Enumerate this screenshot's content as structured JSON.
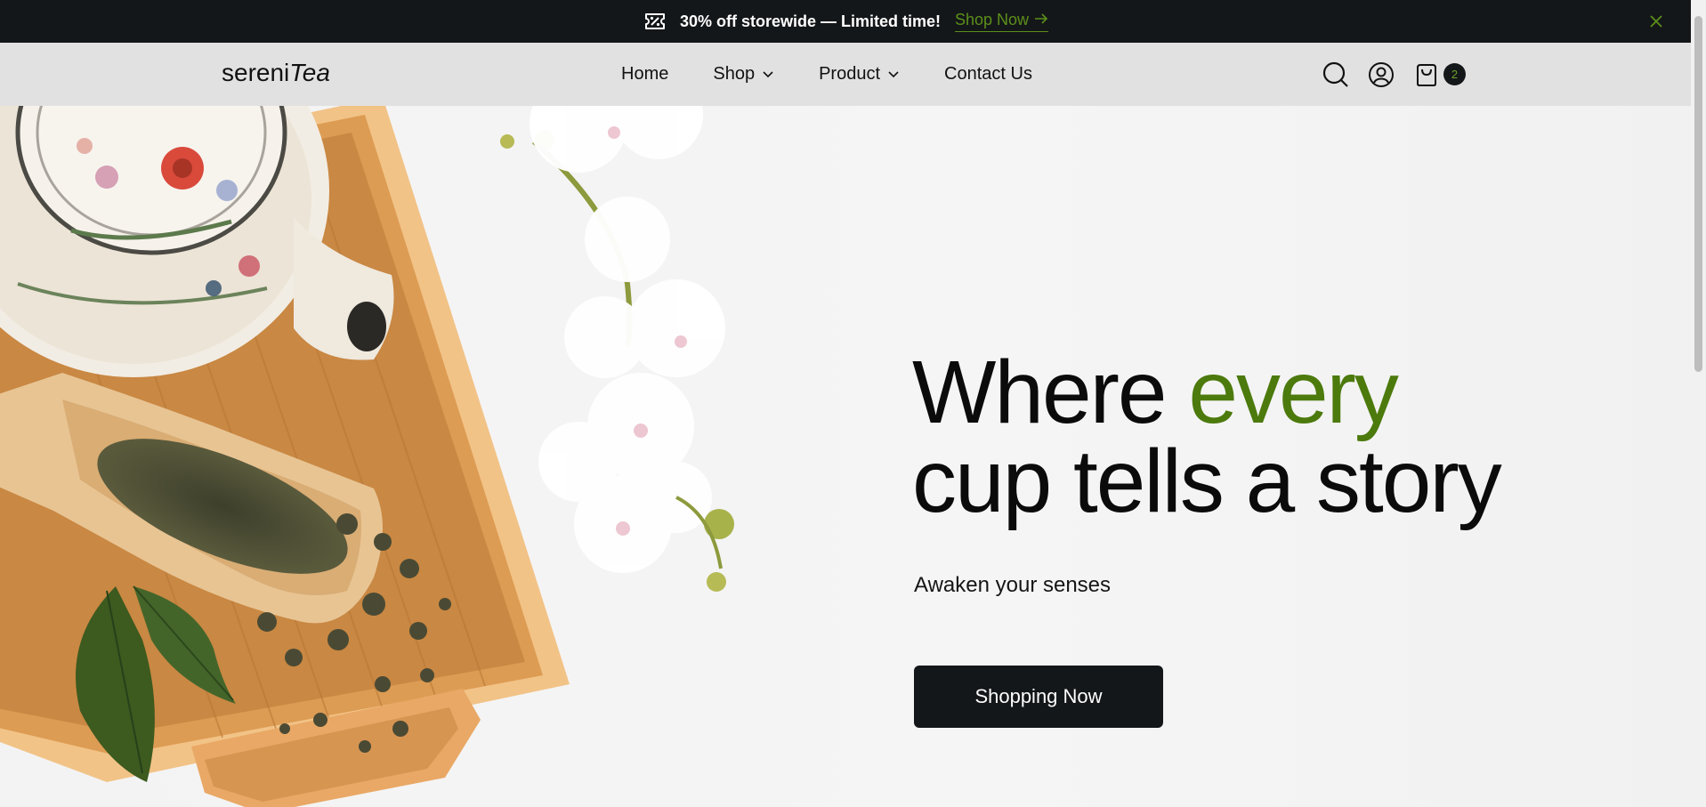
{
  "announcement": {
    "text": "30% off storewide — Limited time!",
    "link_label": "Shop Now",
    "icons": {
      "promo": "discount-ticket-icon",
      "arrow": "arrow-right-icon",
      "close": "close-icon"
    },
    "link_color": "#5c8f1a"
  },
  "header": {
    "logo_regular": "sereni",
    "logo_italic": "Tea",
    "nav": [
      {
        "label": "Home",
        "dropdown": false
      },
      {
        "label": "Shop",
        "dropdown": true
      },
      {
        "label": "Product",
        "dropdown": true
      },
      {
        "label": "Contact Us",
        "dropdown": false
      }
    ],
    "icons": [
      "search-icon",
      "account-icon",
      "shopping-bag-icon"
    ],
    "cart_count": "2"
  },
  "hero": {
    "headline_start": "Where ",
    "headline_accent": "every",
    "headline_end": "cup tells a story",
    "subline": "Awaken your senses",
    "cta_label": "Shopping Now",
    "accent_color": "#4c7a0d",
    "image_subject": "teapot-and-green-tea-on-bamboo-tray-with-orchids"
  },
  "colors": {
    "dark": "#141719",
    "header_bg": "#e2e1e1",
    "hero_bg": "#f4f4f4"
  }
}
